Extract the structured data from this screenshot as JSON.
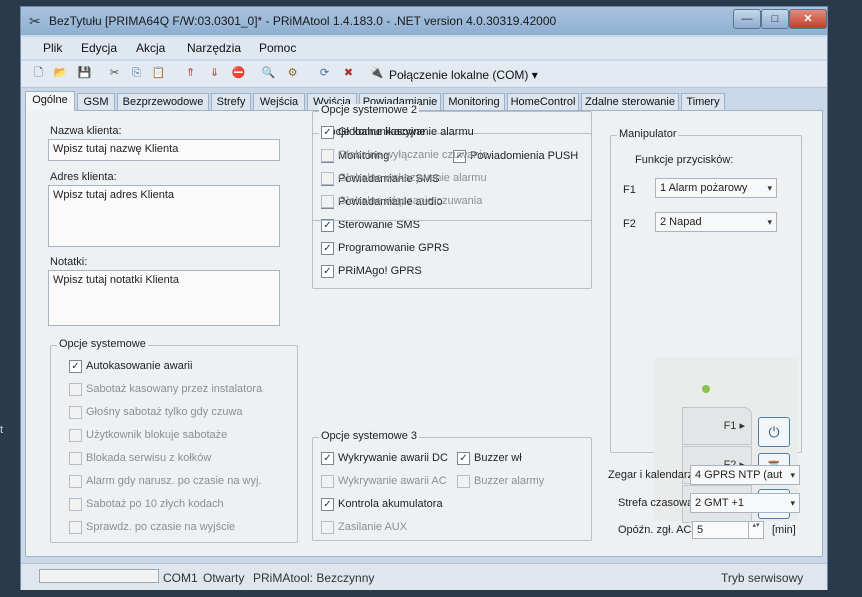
{
  "window": {
    "title": "BezTytułu [PRIMA64Q F/W:03.0301_0]* - PRiMAtool 1.4.183.0 - .NET version 4.0.30319.42000",
    "min_glyph": "—",
    "max_glyph": "□",
    "close_glyph": "✕",
    "app_glyph": "✂"
  },
  "menu": [
    "Plik",
    "Edycja",
    "Akcja",
    "Narzędzia",
    "Pomoc"
  ],
  "toolbar": {
    "icons": [
      "new-icon",
      "open-icon",
      "save-icon",
      "cut-icon",
      "copy-icon",
      "paste-icon",
      "upload-icon",
      "download-icon",
      "stop-icon",
      "search-icon",
      "settings-icon",
      "refresh-icon",
      "disconnect-icon",
      "connect-icon"
    ],
    "glyphs": [
      "🗋",
      "📂",
      "💾",
      "✂",
      "⎘",
      "📋",
      "⇑",
      "⇓",
      "⛔",
      "🔍",
      "⚙",
      "⟳",
      "✖",
      "🔌"
    ],
    "connection_label": "Połączenie lokalne (COM)",
    "connection_arrow": "▾"
  },
  "tabs": [
    "Ogólne",
    "GSM",
    "Bezprzewodowe",
    "Strefy",
    "Wejścia",
    "Wyjścia",
    "Powiadamianie",
    "Monitoring",
    "HomeControl",
    "Zdalne sterowanie",
    "Timery"
  ],
  "client": {
    "name_label": "Nazwa klienta:",
    "name_value": "Wpisz tutaj nazwę Klienta",
    "address_label": "Adres klienta:",
    "address_value": "Wpisz tutaj adres Klienta",
    "notes_label": "Notatki:",
    "notes_value": "Wpisz tutaj notatki Klienta"
  },
  "system_options": {
    "title": "Opcje systemowe",
    "items": [
      {
        "label": "Autokasowanie awarii",
        "checked": "✓"
      },
      {
        "label": "Sabotaż kasowany przez instalatora",
        "checked": ""
      },
      {
        "label": "Głośny sabotaż tylko gdy czuwa",
        "checked": ""
      },
      {
        "label": "Użytkownik blokuje sabotaże",
        "checked": ""
      },
      {
        "label": "Blokada serwisu z kołków",
        "checked": ""
      },
      {
        "label": "Alarm gdy narusz. po czasie na wyj.",
        "checked": ""
      },
      {
        "label": "Sabotaż po 10 złych kodach",
        "checked": ""
      },
      {
        "label": "Sprawdz. po czasie na wyjście",
        "checked": ""
      }
    ]
  },
  "comm_options": {
    "title": "Opcje komunikacyjne",
    "items": [
      {
        "label": "Monitoring",
        "checked": "✓"
      },
      {
        "label": "Powiadamianie SMS",
        "checked": "✓"
      },
      {
        "label": "Powiadamianie audio",
        "checked": ""
      },
      {
        "label": "Sterowanie SMS",
        "checked": "✓"
      },
      {
        "label": "Programowanie GPRS",
        "checked": "✓"
      },
      {
        "label": "PRiMAgo! GPRS",
        "checked": "✓"
      }
    ],
    "push": {
      "label": "Powiadomienia PUSH",
      "checked": "✓"
    }
  },
  "system_options_2": {
    "title": "Opcje systemowe 2",
    "items": [
      {
        "label": "Globalne kasowanie alarmu",
        "checked": "✓"
      },
      {
        "label": "Globalne wyłączanie czuwania",
        "checked": ""
      },
      {
        "label": "Globalne wskazywanie alarmu",
        "checked": ""
      },
      {
        "label": "Globalne włączanie czuwania",
        "checked": ""
      }
    ]
  },
  "system_options_3": {
    "title": "Opcje systemowe 3",
    "items": [
      {
        "label": "Wykrywanie awarii DC",
        "checked": "✓"
      },
      {
        "label": "Wykrywanie awarii AC",
        "checked": ""
      },
      {
        "label": "Kontrola akumulatora",
        "checked": "✓"
      },
      {
        "label": "Zasilanie AUX",
        "checked": ""
      }
    ],
    "buzzer_wl": {
      "label": "Buzzer wł",
      "checked": "✓"
    },
    "buzzer_alarm": {
      "label": "Buzzer alarmy",
      "checked": ""
    }
  },
  "manipulator": {
    "title": "Manipulator",
    "func_label": "Funkcje przycisków:",
    "f1_label": "F1",
    "f1_value": "1 Alarm pożarowy",
    "f2_label": "F2",
    "f2_value": "2 Napad",
    "key_f1": "F1 ▸",
    "key_f2": "F2 ▸",
    "key_3": "▸",
    "icon_1": "⏻",
    "icon_2": "⌛",
    "icon_3": "▤",
    "dropdown_arrow": "▾"
  },
  "clock": {
    "label": "Zegar i kalendarz",
    "value": "4 GPRS NTP (aut",
    "tz_label": "Strefa czasowa",
    "tz_value": "2 GMT +1",
    "delay_label": "Opóźn. zgł. AC",
    "delay_value": "5",
    "delay_unit": "[min]",
    "spin_glyph": "▴▾"
  },
  "status": {
    "port": "COM1",
    "state": "Otwarty",
    "app_state": "PRiMAtool: Bezczynny",
    "mode": "Tryb serwisowy"
  },
  "desktop": {
    "edge_text": "t"
  }
}
